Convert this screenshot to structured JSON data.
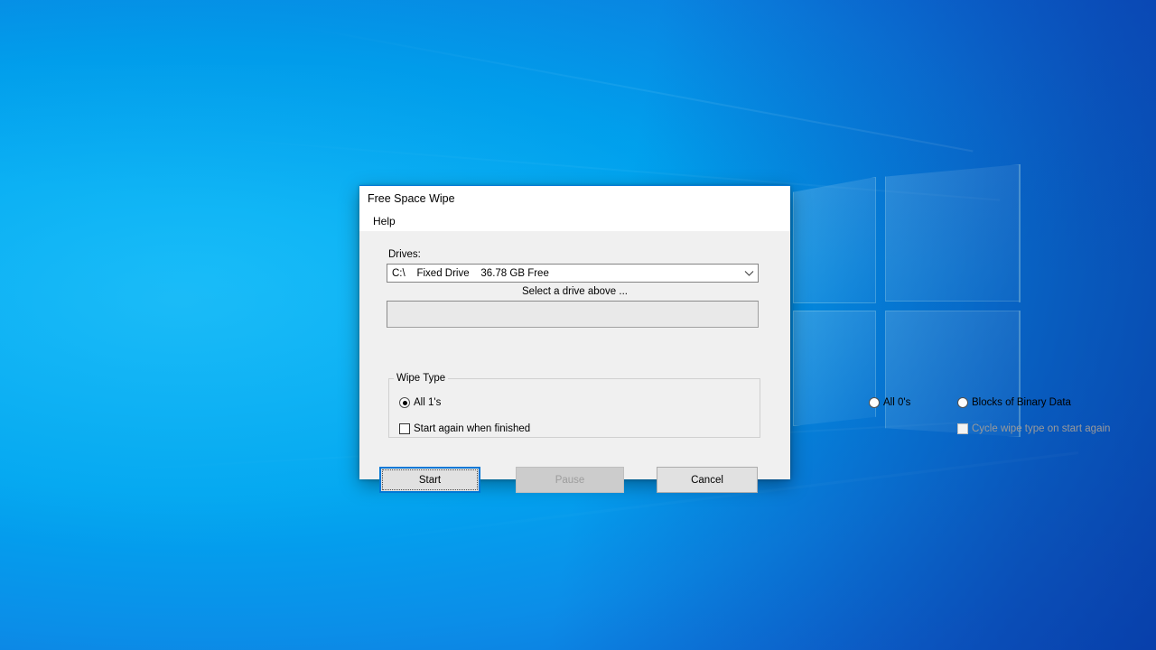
{
  "desktop": {
    "wallpaper_name": "windows-10-hero-wallpaper",
    "colors": {
      "light_blue": "#00a8f0",
      "deep_blue": "#0b5fd0",
      "pane_glow": "#96f5ff"
    }
  },
  "dialog": {
    "title": "Free Space Wipe",
    "accent_color": "#0078d7",
    "face_color": "#f0f0f0",
    "menu": [
      {
        "label": "Help",
        "name": "menu-item-help"
      }
    ],
    "drives": {
      "label": "Drives:",
      "selected": "C:\\    Fixed Drive    36.78 GB Free",
      "options": [
        "C:\\    Fixed Drive    36.78 GB Free"
      ],
      "arrow_icon": "chevron-down-icon"
    },
    "status_text": "Select a drive above ...",
    "progress": {
      "value": 0,
      "max": 100,
      "text": ""
    },
    "wipe_type": {
      "legend": "Wipe Type",
      "radios": [
        {
          "label": "All 1's",
          "checked": true,
          "disabled": false
        },
        {
          "label": "All 0's",
          "checked": false,
          "disabled": false
        },
        {
          "label": "Blocks of Binary Data",
          "checked": false,
          "disabled": false
        }
      ],
      "checkboxes": [
        {
          "label": "Start again when finished",
          "checked": false,
          "disabled": false
        },
        {
          "label": "Cycle wipe type on start again",
          "checked": false,
          "disabled": true
        }
      ]
    },
    "buttons": {
      "start": {
        "label": "Start",
        "disabled": false,
        "focused": true
      },
      "pause": {
        "label": "Pause",
        "disabled": true,
        "focused": false
      },
      "cancel": {
        "label": "Cancel",
        "disabled": false,
        "focused": false
      }
    }
  }
}
